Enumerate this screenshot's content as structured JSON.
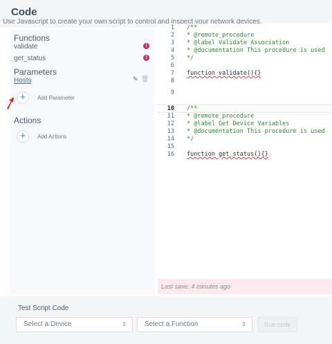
{
  "header": {
    "title": "Code",
    "subtitle": "Use Javascript to create your own script to control and inspect your network devices."
  },
  "sidebar": {
    "functions_title": "Functions",
    "functions": [
      {
        "name": "validate",
        "status": "warning-icon"
      },
      {
        "name": "get_status",
        "status": "warning-icon"
      }
    ],
    "parameters_title": "Parameters",
    "parameters": [
      {
        "name": "Hosts"
      }
    ],
    "add_parameter_label": "Add Parameter",
    "actions_title": "Actions",
    "add_actions_label": "Add Actions"
  },
  "editor": {
    "lines": [
      {
        "n": "1",
        "text": "/**"
      },
      {
        "n": "2",
        "text": "* @remote_procedure"
      },
      {
        "n": "3",
        "text": "* @label Validate Association"
      },
      {
        "n": "4",
        "text": "* @documentation This procedure is used"
      },
      {
        "n": "5",
        "text": "*/"
      },
      {
        "n": "6",
        "text": ""
      },
      {
        "n": "7",
        "text": "function validate(){}"
      },
      {
        "n": "8",
        "text": ""
      },
      {
        "n": "9",
        "text": ""
      },
      {
        "n": "10",
        "text": "/**"
      },
      {
        "n": "11",
        "text": "* @remote_procedure"
      },
      {
        "n": "12",
        "text": "* @label Get Device Variables"
      },
      {
        "n": "13",
        "text": "* @documentation This procedure is used"
      },
      {
        "n": "14",
        "text": "*/"
      },
      {
        "n": "15",
        "text": ""
      },
      {
        "n": "16",
        "text": "function get_status(){}"
      }
    ],
    "active_line": "10",
    "last_save": "Last save: 4 minutes ago"
  },
  "test": {
    "title": "Test Script Code",
    "device_select": "Select a Device",
    "function_select": "Select a Function",
    "run_label": "Run code"
  },
  "colors": {
    "accent": "#3b87d8",
    "warning": "#c0346a",
    "comment": "#2e8b2e",
    "arrow": "#e02020"
  }
}
